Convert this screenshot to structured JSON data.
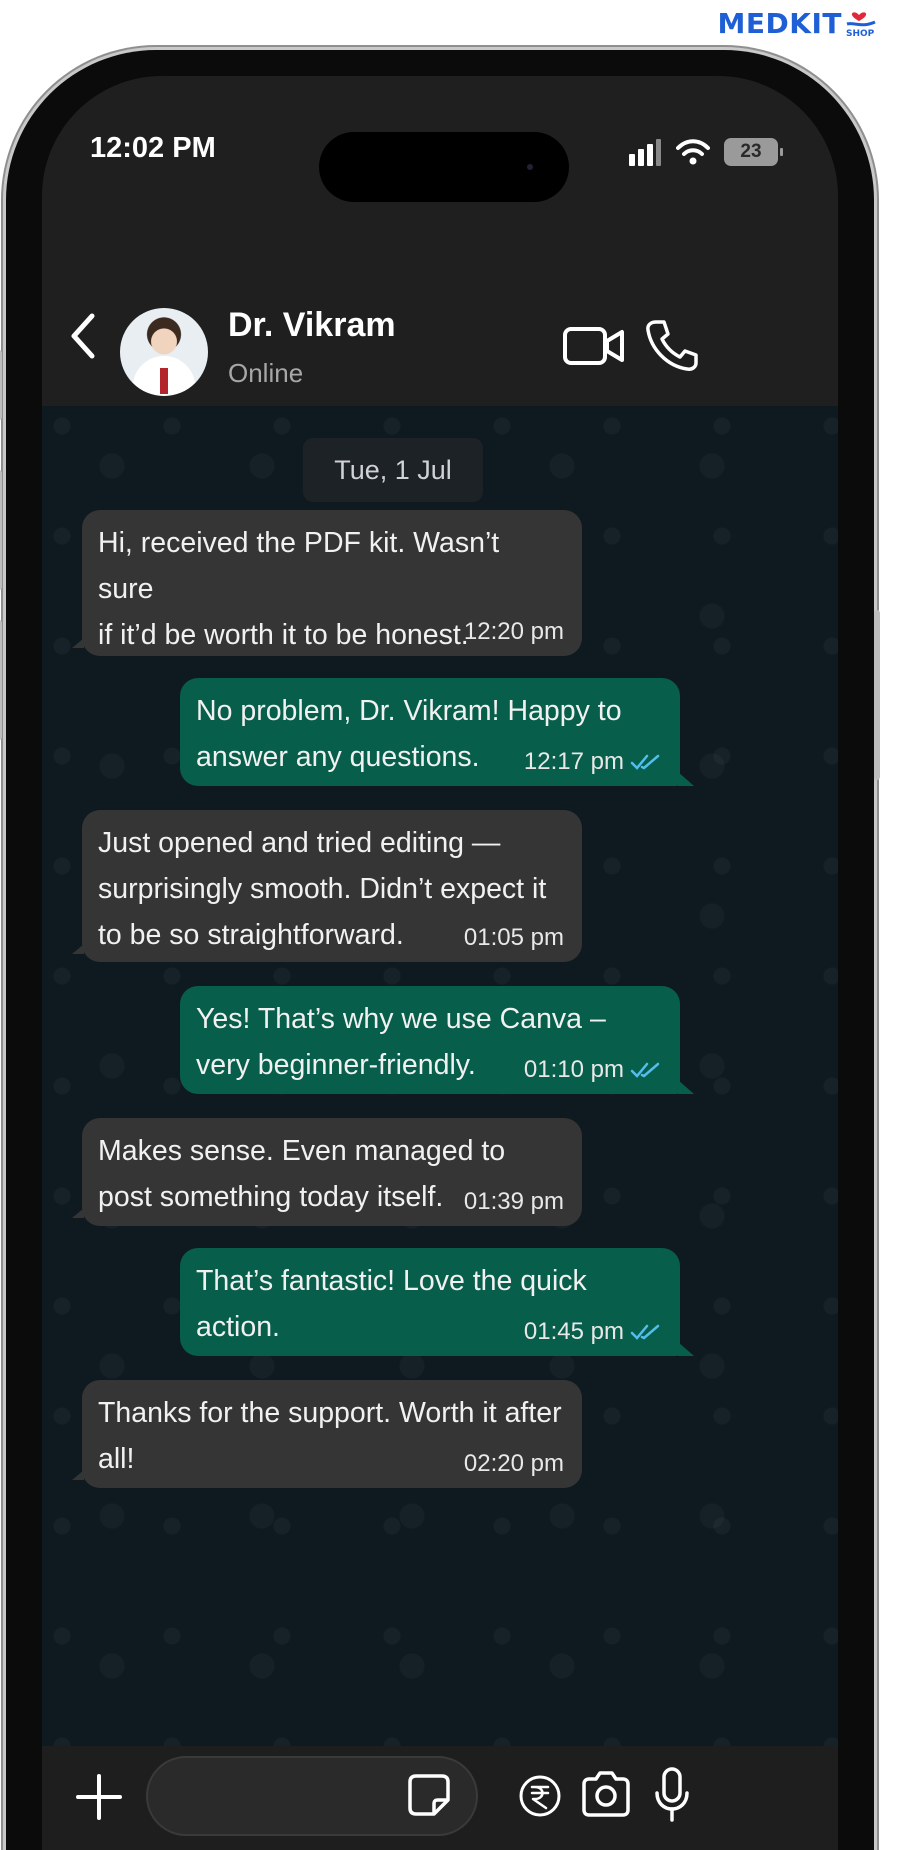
{
  "brand": {
    "name": "MEDKIT",
    "suffix": "SHOP"
  },
  "status_bar": {
    "time": "12:02 PM",
    "battery": "23"
  },
  "chat_header": {
    "contact_name": "Dr. Vikram",
    "contact_status": "Online",
    "icons": [
      "back-chevron-icon",
      "video-call-icon",
      "phone-call-icon"
    ]
  },
  "chat": {
    "date_chip": "Tue, 1 Jul",
    "messages": [
      {
        "direction": "in",
        "text": "Hi, received the PDF kit. Wasn’t sure\nif it’d be worth it to be honest.",
        "time": "12:20 pm"
      },
      {
        "direction": "out",
        "text": "No problem, Dr. Vikram! Happy to\nanswer any questions.",
        "time": "12:17 pm",
        "read": true
      },
      {
        "direction": "in",
        "text": "Just opened and tried editing —\nsurprisingly smooth. Didn’t expect it\nto be so straightforward.",
        "time": "01:05 pm"
      },
      {
        "direction": "out",
        "text": "Yes! That’s why we use Canva –\nvery beginner-friendly.",
        "time": "01:10 pm",
        "read": true
      },
      {
        "direction": "in",
        "text": "Makes sense. Even managed to\npost something today itself.",
        "time": "01:39 pm"
      },
      {
        "direction": "out",
        "text": "That’s fantastic! Love the quick\naction.",
        "time": "01:45 pm",
        "read": true
      },
      {
        "direction": "in",
        "text": "Thanks for the support. Worth it after\nall!",
        "time": "02:20 pm"
      }
    ]
  },
  "input_bar": {
    "message_value": "",
    "icons": [
      "plus-icon",
      "sticker-icon",
      "rupee-icon",
      "camera-icon",
      "microphone-icon"
    ]
  },
  "colors": {
    "incoming_bubble": "#353535",
    "outgoing_bubble": "#075e4b",
    "chat_background": "#0e1a20",
    "header_background": "#1f1f1f",
    "read_ticks": "#53bdeb",
    "brand": "#1f5fd6"
  }
}
